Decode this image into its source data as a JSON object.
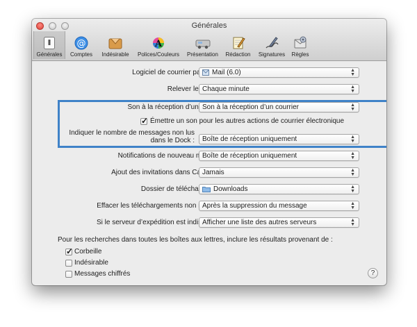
{
  "window": {
    "title": "Générales"
  },
  "toolbar": [
    {
      "label": "Générales",
      "icon": "switch-icon"
    },
    {
      "label": "Comptes",
      "icon": "at-sign-icon"
    },
    {
      "label": "Indésirable",
      "icon": "junk-icon"
    },
    {
      "label": "Polices/Couleurs",
      "icon": "fonts-colors-icon"
    },
    {
      "label": "Présentation",
      "icon": "viewing-icon"
    },
    {
      "label": "Rédaction",
      "icon": "composing-icon"
    },
    {
      "label": "Signatures",
      "icon": "signature-pen-icon"
    },
    {
      "label": "Règles",
      "icon": "rules-icon"
    }
  ],
  "settings": {
    "default_mail": {
      "label": "Logiciel de courrier par défaut :",
      "value": "Mail (6.0)",
      "icon": "mail-stamp-icon"
    },
    "check_mail": {
      "label": "Relever le courrier :",
      "value": "Chaque minute"
    },
    "new_mail_sound": {
      "label": "Son à la réception d’un courrier :",
      "value": "Son à la réception d’un courrier"
    },
    "other_sounds": {
      "label": "Émettre un son pour les autres actions de courrier électronique",
      "checked": true
    },
    "dock_count": {
      "label_line1": "Indiquer le nombre de messages non lus",
      "label_line2": "dans le Dock :",
      "value": "Boîte de réception uniquement"
    },
    "notifications": {
      "label": "Notifications de nouveau message :",
      "value": "Boîte de réception uniquement"
    },
    "invitations": {
      "label": "Ajout des invitations dans Calendrier :",
      "value": "Jamais"
    },
    "download_folder": {
      "label": "Dossier de téléchargement :",
      "value": "Downloads",
      "icon": "folder-icon"
    },
    "remove_downloads": {
      "label": "Effacer les téléchargements non modifiés :",
      "value": "Après la suppression du message"
    },
    "server_unavailable": {
      "label": "Si le serveur d’expédition est indisponible :",
      "value": "Afficher une liste des autres serveurs"
    }
  },
  "search": {
    "intro": "Pour les recherches dans toutes les boîtes aux lettres, inclure les résultats provenant de :",
    "options": [
      {
        "label": "Corbeille",
        "checked": true
      },
      {
        "label": "Indésirable",
        "checked": false
      },
      {
        "label": "Messages chiffrés",
        "checked": false
      }
    ]
  },
  "help": {
    "label": "?"
  },
  "colors": {
    "highlight": "#3f82c8"
  }
}
